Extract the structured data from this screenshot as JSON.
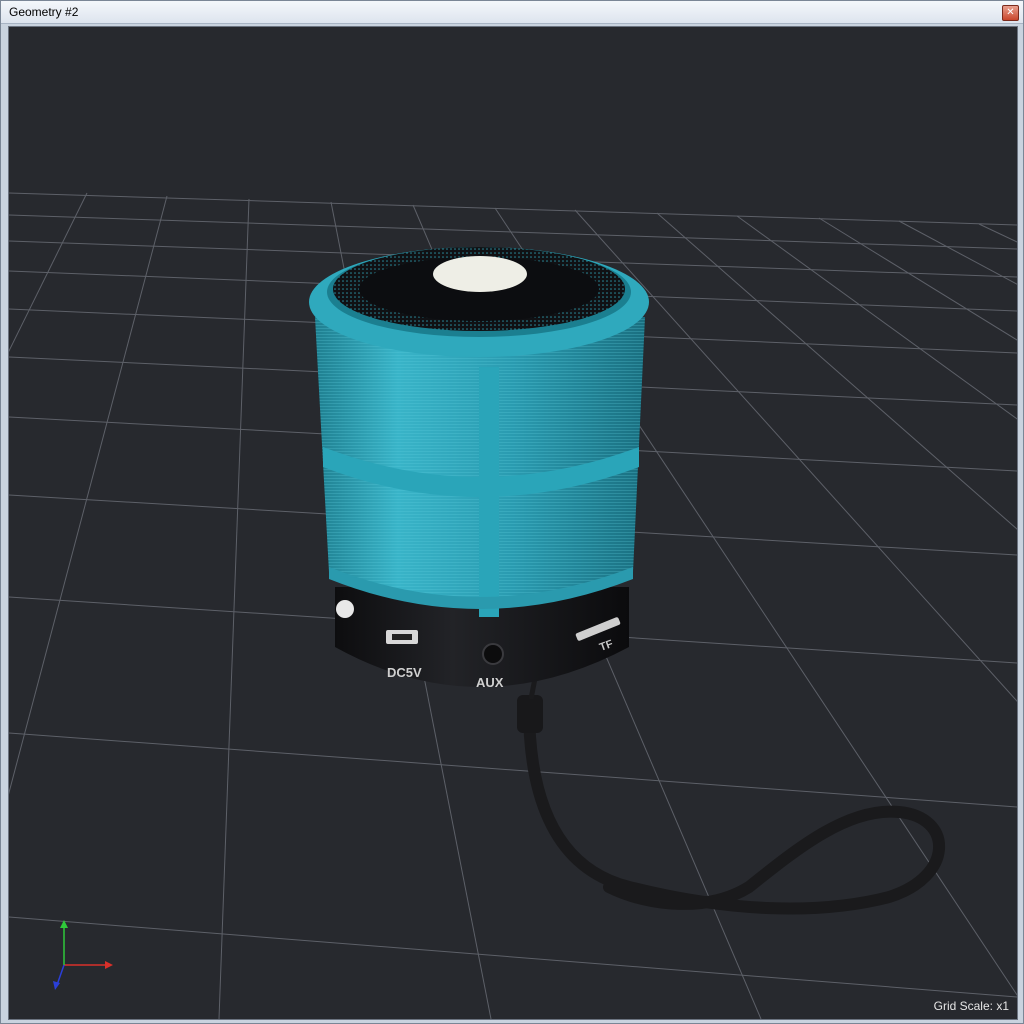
{
  "window": {
    "title": "Geometry #2",
    "close_glyph": "✕"
  },
  "viewport": {
    "background": "#27292e",
    "grid_color": "#5d6068",
    "status": {
      "grid_scale": "Grid Scale: x1"
    }
  },
  "model": {
    "body_color": "#2fa0b3",
    "base_color": "#141416",
    "labels": {
      "power": "DC5V",
      "aux": "AUX",
      "card": "TF"
    }
  },
  "axis_gizmo": {
    "x_color": "#d9302a",
    "y_color": "#2fc93a",
    "z_color": "#2a3fd9"
  }
}
